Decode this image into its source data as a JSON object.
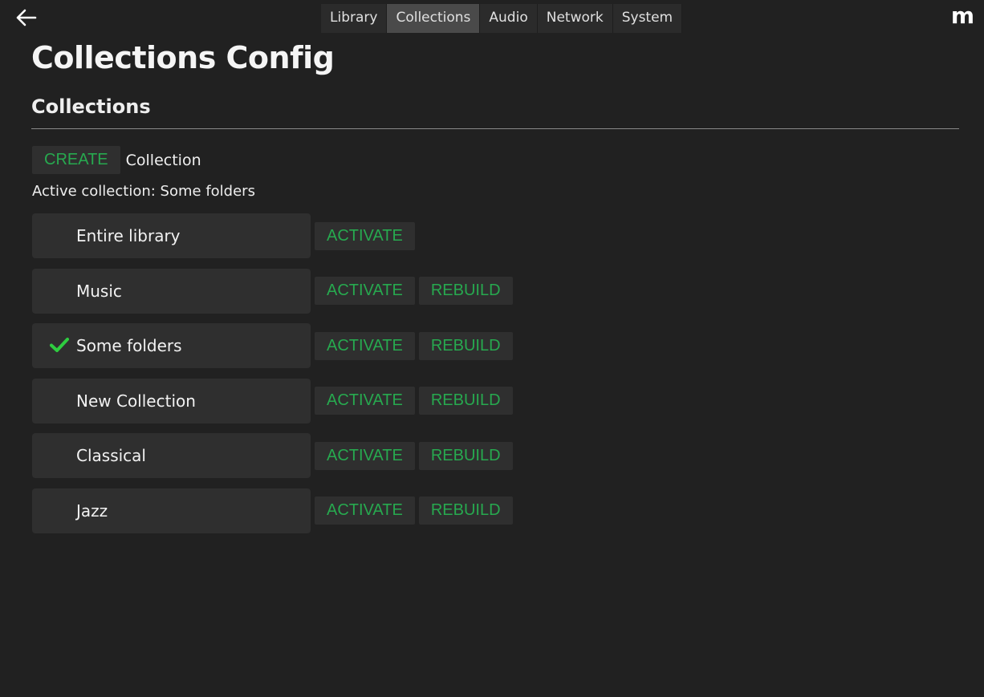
{
  "nav": {
    "back_icon": "arrow-left-icon",
    "logo_text": "m",
    "tabs": [
      {
        "label": "Library",
        "active": false
      },
      {
        "label": "Collections",
        "active": true
      },
      {
        "label": "Audio",
        "active": false
      },
      {
        "label": "Network",
        "active": false
      },
      {
        "label": "System",
        "active": false
      }
    ]
  },
  "page": {
    "title": "Collections Config",
    "section_title": "Collections"
  },
  "create": {
    "button_label": "CREATE",
    "label": "Collection"
  },
  "active_collection": "Active collection: Some folders",
  "collections": [
    {
      "name": "Entire library",
      "active": false,
      "activate_label": "ACTIVATE",
      "rebuild_label": ""
    },
    {
      "name": "Music",
      "active": false,
      "activate_label": "ACTIVATE",
      "rebuild_label": "REBUILD"
    },
    {
      "name": "Some folders",
      "active": true,
      "activate_label": "ACTIVATE",
      "rebuild_label": "REBUILD"
    },
    {
      "name": "New Collection",
      "active": false,
      "activate_label": "ACTIVATE",
      "rebuild_label": "REBUILD"
    },
    {
      "name": "Classical",
      "active": false,
      "activate_label": "ACTIVATE",
      "rebuild_label": "REBUILD"
    },
    {
      "name": "Jazz",
      "active": false,
      "activate_label": "ACTIVATE",
      "rebuild_label": "REBUILD"
    }
  ],
  "colors": {
    "background": "#212121",
    "accent_green": "#27a94f",
    "check_green": "#2ecc40",
    "active_tab": "#4a4a4a"
  }
}
